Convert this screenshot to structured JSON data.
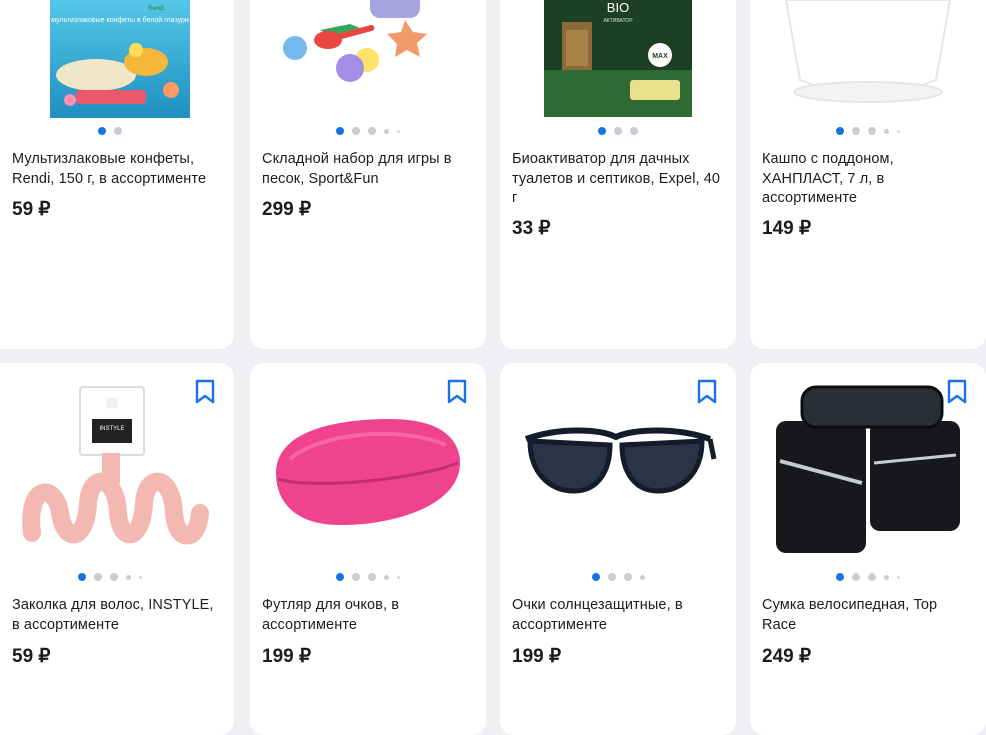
{
  "currency": "₽",
  "products": [
    {
      "title": "Мультизлаковые конфеты, Rendi, 150 г, в ассортименте",
      "price": "59 ₽",
      "images": 2,
      "active_image": 1
    },
    {
      "title": "Складной набор для игры в песок, Sport&Fun",
      "price": "299 ₽",
      "images": 5,
      "active_image": 1
    },
    {
      "title": "Биоактиватор для дачных туалетов и септиков, Expel, 40 г",
      "price": "33 ₽",
      "images": 3,
      "active_image": 1
    },
    {
      "title": "Кашпо с поддоном, ХАНПЛАСТ, 7 л, в ассортименте",
      "price": "149 ₽",
      "images": 5,
      "active_image": 1
    },
    {
      "title": "Заколка для волос, INSTYLE, в ассортименте",
      "price": "59 ₽",
      "images": 5,
      "active_image": 1
    },
    {
      "title": "Футляр для очков, в ассортименте",
      "price": "199 ₽",
      "images": 5,
      "active_image": 1
    },
    {
      "title": "Очки солнцезащитные, в ассортименте",
      "price": "199 ₽",
      "images": 4,
      "active_image": 1
    },
    {
      "title": "Сумка велосипедная, Top Race",
      "price": "249 ₽",
      "images": 5,
      "active_image": 1
    }
  ],
  "image_text": {
    "candy_pack": "мультизлаковые конфеты в белой глазури",
    "candy_brand": "Rendi",
    "bio_pack": "BIO",
    "bio_sub": "АКТИВАТОР",
    "bio_max": "MAX",
    "hairclip_tag": "INSTYLE"
  },
  "colors": {
    "accent": "#1673e6",
    "page_bg": "#eef0f3",
    "card_bg": "#ffffff"
  }
}
